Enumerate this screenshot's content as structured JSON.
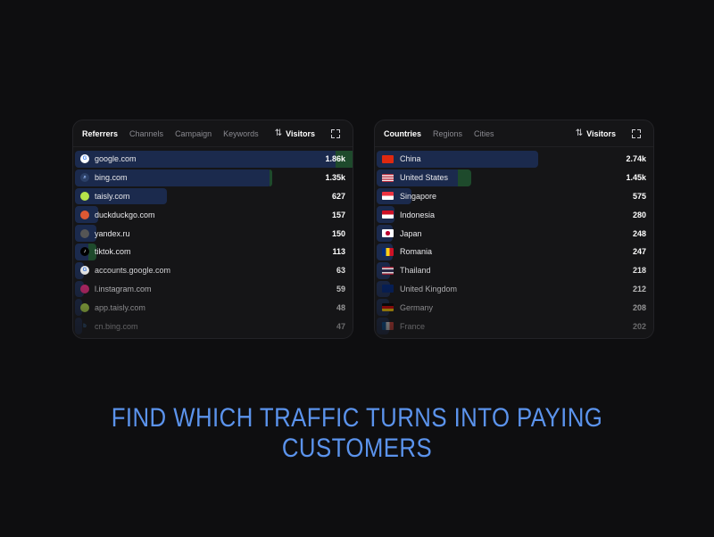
{
  "referrers_panel": {
    "tabs": [
      "Referrers",
      "Channels",
      "Campaign",
      "Keywords"
    ],
    "sort_label": "Visitors",
    "rows": [
      {
        "label": "google.com",
        "value": "1.86k",
        "icon": "google-icon",
        "visitors_fraction": 1.0,
        "paid_fraction": 0.09
      },
      {
        "label": "bing.com",
        "value": "1.35k",
        "icon": "bing-search-icon",
        "visitors_fraction": 0.725,
        "paid_fraction": 0.01
      },
      {
        "label": "taisly.com",
        "value": "627",
        "icon": "taisly-icon",
        "visitors_fraction": 0.34,
        "paid_fraction": 0
      },
      {
        "label": "duckduckgo.com",
        "value": "157",
        "icon": "duckduckgo-icon",
        "visitors_fraction": 0.085,
        "paid_fraction": 0
      },
      {
        "label": "yandex.ru",
        "value": "150",
        "icon": "yandex-icon",
        "visitors_fraction": 0.08,
        "paid_fraction": 0
      },
      {
        "label": "tiktok.com",
        "value": "113",
        "icon": "tiktok-icon",
        "visitors_fraction": 0.06,
        "paid_fraction": 0.03
      },
      {
        "label": "accounts.google.com",
        "value": "63",
        "icon": "google-icon",
        "visitors_fraction": 0.034,
        "paid_fraction": 0
      },
      {
        "label": "l.instagram.com",
        "value": "59",
        "icon": "instagram-icon",
        "visitors_fraction": 0.032,
        "paid_fraction": 0
      },
      {
        "label": "app.taisly.com",
        "value": "48",
        "icon": "taisly-icon",
        "visitors_fraction": 0.026,
        "paid_fraction": 0
      },
      {
        "label": "cn.bing.com",
        "value": "47",
        "icon": "bing-icon",
        "visitors_fraction": 0.025,
        "paid_fraction": 0
      }
    ]
  },
  "countries_panel": {
    "tabs": [
      "Countries",
      "Regions",
      "Cities"
    ],
    "sort_label": "Visitors",
    "rows": [
      {
        "label": "China",
        "value": "2.74k",
        "icon": "flag-china-icon",
        "visitors_fraction": 0.6,
        "paid_fraction": 0
      },
      {
        "label": "United States",
        "value": "1.45k",
        "icon": "flag-usa-icon",
        "visitors_fraction": 0.32,
        "paid_fraction": 0.05
      },
      {
        "label": "Singapore",
        "value": "575",
        "icon": "flag-singapore-icon",
        "visitors_fraction": 0.13,
        "paid_fraction": 0
      },
      {
        "label": "Indonesia",
        "value": "280",
        "icon": "flag-indonesia-icon",
        "visitors_fraction": 0.065,
        "paid_fraction": 0
      },
      {
        "label": "Japan",
        "value": "248",
        "icon": "flag-japan-icon",
        "visitors_fraction": 0.058,
        "paid_fraction": 0
      },
      {
        "label": "Romania",
        "value": "247",
        "icon": "flag-romania-icon",
        "visitors_fraction": 0.058,
        "paid_fraction": 0
      },
      {
        "label": "Thailand",
        "value": "218",
        "icon": "flag-thailand-icon",
        "visitors_fraction": 0.05,
        "paid_fraction": 0
      },
      {
        "label": "United Kingdom",
        "value": "212",
        "icon": "flag-uk-icon",
        "visitors_fraction": 0.049,
        "paid_fraction": 0
      },
      {
        "label": "Germany",
        "value": "208",
        "icon": "flag-germany-icon",
        "visitors_fraction": 0.048,
        "paid_fraction": 0
      },
      {
        "label": "France",
        "value": "202",
        "icon": "flag-france-icon",
        "visitors_fraction": 0.047,
        "paid_fraction": 0
      }
    ]
  },
  "colors": {
    "visitors_bar": "#1b2a4d",
    "paid_bar": "#1e4a2c",
    "tagline": "#5b93ec"
  },
  "tagline": "FIND WHICH TRAFFIC TURNS INTO PAYING CUSTOMERS"
}
